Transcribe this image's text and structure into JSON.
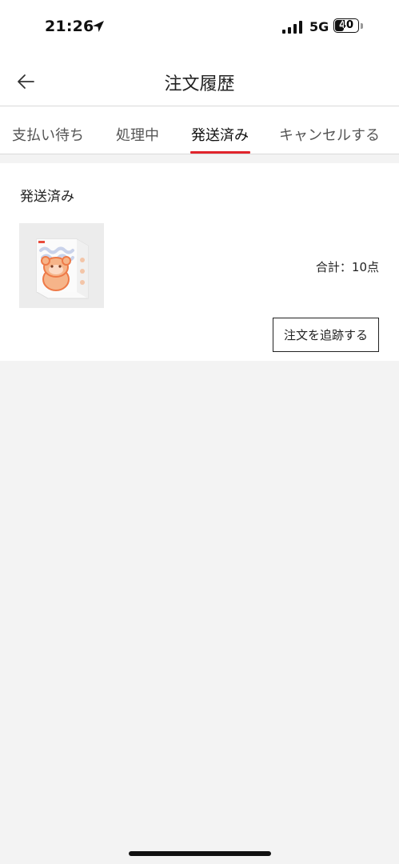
{
  "status_bar": {
    "time": "21:26",
    "location_icon": "location-arrow-icon",
    "signal_icon": "cellular-signal-icon",
    "network": "5G",
    "battery_level": 40,
    "battery_label": "40"
  },
  "header": {
    "back_icon": "arrow-left-icon",
    "title": "注文履歴"
  },
  "tabs": [
    {
      "label": "支払い待ち",
      "active": false
    },
    {
      "label": "処理中",
      "active": false
    },
    {
      "label": "発送済み",
      "active": true
    },
    {
      "label": "キャンセルする",
      "active": false
    }
  ],
  "colors": {
    "accent": "#e0242b",
    "page_background": "#f3f3f3"
  },
  "order": {
    "status": "発送済み",
    "product_image_icon": "blind-box-figure-thumbnail",
    "total_label": "合計：",
    "total_count": "10点",
    "track_button_label": "注文を追跡する"
  }
}
